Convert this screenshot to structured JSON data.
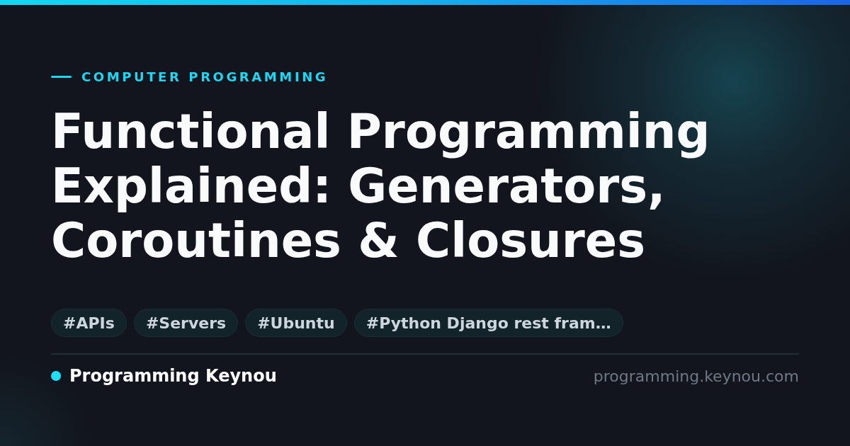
{
  "kicker": "COMPUTER PROGRAMMING",
  "title": "Functional Programming Explained: Generators, Coroutines & Closures",
  "tags": [
    "#APIs",
    "#Servers",
    "#Ubuntu",
    "#Python Django rest fram…"
  ],
  "footer": {
    "brand": "Programming Keynou",
    "url": "programming.keynou.com"
  }
}
